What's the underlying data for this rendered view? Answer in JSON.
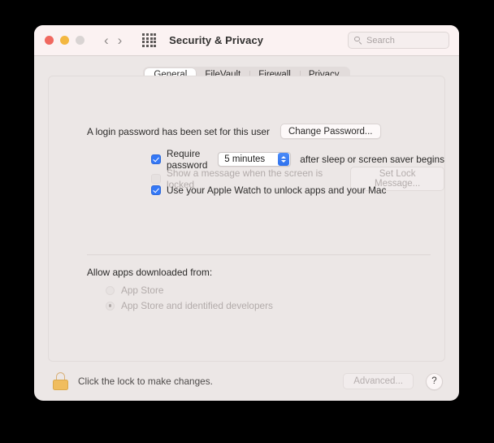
{
  "window": {
    "title": "Security & Privacy",
    "traffic_lights": [
      "close",
      "minimize",
      "zoom"
    ],
    "nav": {
      "back_icon": "chevron-left-icon",
      "forward_icon": "chevron-right-icon"
    },
    "grid_icon": "show-all-grid-icon"
  },
  "search": {
    "placeholder": "Search",
    "value": "",
    "icon": "search-icon"
  },
  "tabs": [
    {
      "label": "General",
      "selected": true
    },
    {
      "label": "FileVault",
      "selected": false
    },
    {
      "label": "Firewall",
      "selected": false
    },
    {
      "label": "Privacy",
      "selected": false
    }
  ],
  "general": {
    "login_password_text": "A login password has been set for this user",
    "change_password_button": "Change Password...",
    "require_password": {
      "checked": true,
      "label": "Require password",
      "delay_value": "5 minutes",
      "suffix_label": "after sleep or screen saver begins",
      "stepper_icon": "stepper-updown-icon"
    },
    "show_message": {
      "checked": false,
      "enabled": false,
      "label": "Show a message when the screen is locked",
      "set_lock_message_button": "Set Lock Message..."
    },
    "apple_watch": {
      "checked": true,
      "label": "Use your Apple Watch to unlock apps and your Mac"
    },
    "allow_apps_label": "Allow apps downloaded from:",
    "allow_apps_options": [
      {
        "label": "App Store",
        "selected": false,
        "enabled": false
      },
      {
        "label": "App Store and identified developers",
        "selected": true,
        "enabled": false
      }
    ]
  },
  "bottom_bar": {
    "lock_icon": "closed-padlock-icon",
    "lock_hint": "Click the lock to make changes.",
    "advanced_button": "Advanced...",
    "advanced_enabled": false,
    "help_button": "?"
  },
  "watermark": "",
  "colors": {
    "accent_blue": "#3478f6",
    "window_bg": "#ece7e6",
    "titlebar_bg": "#fbf2f2",
    "lock_gold": "#f0bd5e",
    "disabled_text": "#b2abaa"
  }
}
